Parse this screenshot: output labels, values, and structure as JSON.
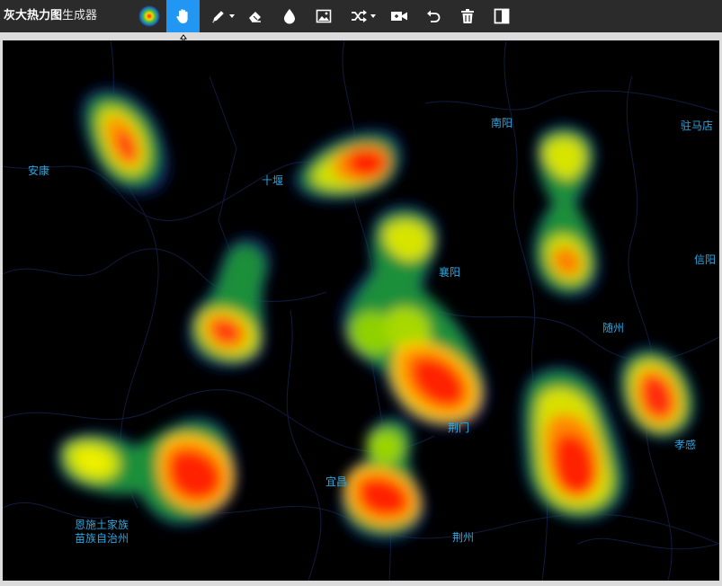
{
  "app": {
    "title_bold": "灰大热力图",
    "title_rest": "生成器"
  },
  "toolbar": {
    "tools": [
      {
        "name": "gradient-icon",
        "tooltip": ""
      },
      {
        "name": "hand-pan-icon",
        "active": true
      },
      {
        "name": "brush-icon",
        "has_dropdown": true
      },
      {
        "name": "eraser-icon"
      },
      {
        "name": "drop-icon"
      },
      {
        "name": "image-icon"
      },
      {
        "name": "shuffle-icon",
        "has_dropdown": true
      },
      {
        "name": "record-icon"
      },
      {
        "name": "undo-icon"
      },
      {
        "name": "trash-icon"
      },
      {
        "name": "split-view-icon"
      }
    ],
    "active_color": "#2196f3",
    "bar_color": "#2b2b2b"
  },
  "map": {
    "background": "#000000",
    "label_color": "#2aa6e0",
    "labels": [
      {
        "id": "ankang",
        "text": "安康"
      },
      {
        "id": "shiyan",
        "text": "十堰"
      },
      {
        "id": "nanyang",
        "text": "南阳"
      },
      {
        "id": "zhumadian",
        "text": "驻马店"
      },
      {
        "id": "xiangyang",
        "text": "襄阳"
      },
      {
        "id": "xinyang",
        "text": "信阳"
      },
      {
        "id": "suizhou",
        "text": "随州"
      },
      {
        "id": "jingmen",
        "text": "荆门"
      },
      {
        "id": "xiaogan",
        "text": "孝感"
      },
      {
        "id": "yichang",
        "text": "宜昌"
      },
      {
        "id": "enshi1",
        "text": "恩施土家族"
      },
      {
        "id": "enshi2",
        "text": "苗族自治州"
      },
      {
        "id": "jingzhou",
        "text": "荆州"
      }
    ],
    "heat_colors": [
      "#0b1a4a",
      "#1e6fd0",
      "#00c060",
      "#7ed000",
      "#f0f000",
      "#ff9000",
      "#ff2000"
    ]
  }
}
